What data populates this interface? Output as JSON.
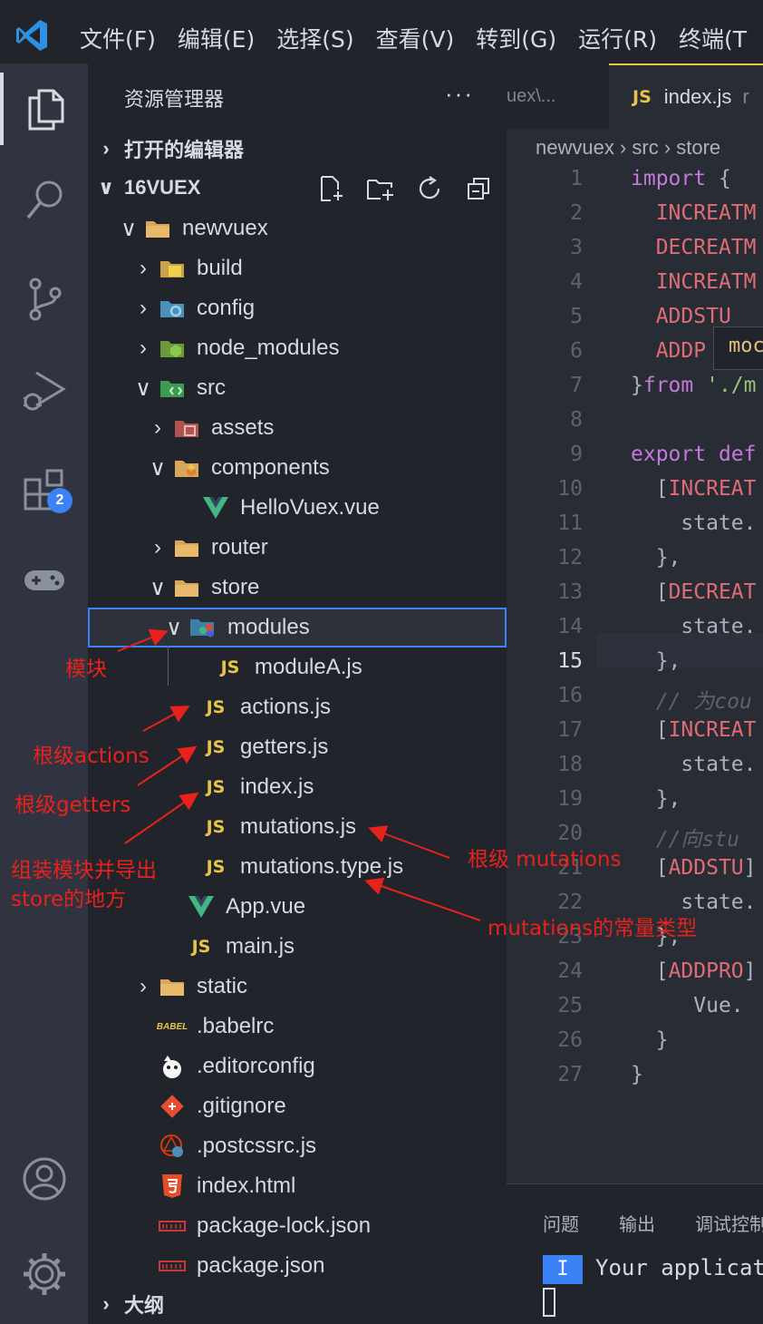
{
  "menu": [
    "文件(F)",
    "编辑(E)",
    "选择(S)",
    "查看(V)",
    "转到(G)",
    "运行(R)",
    "终端(T"
  ],
  "activity_bar": {
    "extensions_badge": "2"
  },
  "sidebar": {
    "title": "资源管理器",
    "more": "···",
    "open_editors": "打开的编辑器",
    "workspace": "16VUEX",
    "outline": "大纲"
  },
  "tree": [
    {
      "label": "newvuex",
      "chev": "∨",
      "icon": "folder-icon"
    },
    {
      "label": "build",
      "chev": "›",
      "icon": "folder-build-icon"
    },
    {
      "label": "config",
      "chev": "›",
      "icon": "folder-config-icon"
    },
    {
      "label": "node_modules",
      "chev": "›",
      "icon": "folder-node-icon"
    },
    {
      "label": "src",
      "chev": "∨",
      "icon": "folder-src-icon"
    },
    {
      "label": "assets",
      "chev": "›",
      "icon": "folder-assets-icon"
    },
    {
      "label": "components",
      "chev": "∨",
      "icon": "folder-components-icon"
    },
    {
      "label": "HelloVuex.vue",
      "chev": "",
      "icon": "vue-icon"
    },
    {
      "label": "router",
      "chev": "›",
      "icon": "folder-icon"
    },
    {
      "label": "store",
      "chev": "∨",
      "icon": "folder-icon"
    },
    {
      "label": "modules",
      "chev": "∨",
      "icon": "folder-modules-icon"
    },
    {
      "label": "moduleA.js",
      "chev": "",
      "icon": "js-icon"
    },
    {
      "label": "actions.js",
      "chev": "",
      "icon": "js-icon"
    },
    {
      "label": "getters.js",
      "chev": "",
      "icon": "js-icon"
    },
    {
      "label": "index.js",
      "chev": "",
      "icon": "js-icon"
    },
    {
      "label": "mutations.js",
      "chev": "",
      "icon": "js-icon"
    },
    {
      "label": "mutations.type.js",
      "chev": "",
      "icon": "js-icon"
    },
    {
      "label": "App.vue",
      "chev": "",
      "icon": "vue-icon"
    },
    {
      "label": "main.js",
      "chev": "",
      "icon": "js-icon"
    },
    {
      "label": "static",
      "chev": "›",
      "icon": "folder-icon"
    },
    {
      "label": ".babelrc",
      "chev": "",
      "icon": "babel-icon"
    },
    {
      "label": ".editorconfig",
      "chev": "",
      "icon": "editorconfig-icon"
    },
    {
      "label": ".gitignore",
      "chev": "",
      "icon": "git-icon"
    },
    {
      "label": ".postcssrc.js",
      "chev": "",
      "icon": "postcss-icon"
    },
    {
      "label": "index.html",
      "chev": "",
      "icon": "html5-icon"
    },
    {
      "label": "package-lock.json",
      "chev": "",
      "icon": "npm-icon"
    },
    {
      "label": "package.json",
      "chev": "",
      "icon": "npm-icon"
    }
  ],
  "js_label": "JS",
  "icon_text": {
    "babel": "BABEL"
  },
  "editor": {
    "tab_inactive": "uex\\...",
    "tab_active": "index.js",
    "tab_active_suffix": "r",
    "breadcrumb": "newvuex › src › store",
    "hover_text": "moc",
    "lines": [
      {
        "n": "1",
        "html": "<span class='kw'>import</span> <span class='pl'>{</span>"
      },
      {
        "n": "2",
        "html": "  <span class='cn'>INCREATM</span>"
      },
      {
        "n": "3",
        "html": "  <span class='cn'>DECREATM</span>"
      },
      {
        "n": "4",
        "html": "  <span class='cn'>INCREATM</span>"
      },
      {
        "n": "5",
        "html": "  <span class='cn'>ADDSTU</span>"
      },
      {
        "n": "6",
        "html": "  <span class='cn'>ADDP</span>"
      },
      {
        "n": "7",
        "html": "<span class='pl'>}</span><span class='kw'>from</span> <span class='st'>'./m</span>"
      },
      {
        "n": "8",
        "html": ""
      },
      {
        "n": "9",
        "html": "<span class='kw'>export</span> <span class='kw'>def</span>"
      },
      {
        "n": "10",
        "html": "  <span class='pl'>[</span><span class='cn'>INCREAT</span>"
      },
      {
        "n": "11",
        "html": "    <span class='pl'>state.</span>"
      },
      {
        "n": "12",
        "html": "  <span class='pl'>},</span>"
      },
      {
        "n": "13",
        "html": "  <span class='pl'>[</span><span class='cn'>DECREAT</span>"
      },
      {
        "n": "14",
        "html": "    <span class='pl'>state.</span>"
      },
      {
        "n": "15",
        "html": "  <span class='pl'>},</span>"
      },
      {
        "n": "16",
        "html": "  <span class='cm'>// 为cou</span>"
      },
      {
        "n": "17",
        "html": "  <span class='pl'>[</span><span class='cn'>INCREAT</span>"
      },
      {
        "n": "18",
        "html": "    <span class='pl'>state.</span>"
      },
      {
        "n": "19",
        "html": "  <span class='pl'>},</span>"
      },
      {
        "n": "20",
        "html": "  <span class='cm'>//向stu</span>"
      },
      {
        "n": "21",
        "html": "  <span class='pl'>[</span><span class='cn'>ADDSTU</span><span class='pl'>]</span>"
      },
      {
        "n": "22",
        "html": "    <span class='pl'>state.</span>"
      },
      {
        "n": "23",
        "html": "  <span class='pl'>},</span>"
      },
      {
        "n": "24",
        "html": "  <span class='pl'>[</span><span class='cn'>ADDPRO</span><span class='pl'>]</span>"
      },
      {
        "n": "25",
        "html": "     <span class='pl'>Vue.</span>"
      },
      {
        "n": "26",
        "html": "  <span class='pl'>}</span>"
      },
      {
        "n": "27",
        "html": "<span class='pl'>}</span>"
      }
    ],
    "current_line": "15"
  },
  "panel": {
    "tabs": [
      "问题",
      "输出",
      "调试控制"
    ],
    "info_badge": "I",
    "terminal_text": "Your applicat"
  },
  "annotations": {
    "modules": "模块",
    "actions": "根级actions",
    "getters": "根级getters",
    "index_line1": "组装模块并导出",
    "index_line2": "store的地方",
    "mutations": "根级 mutations",
    "mutations_type": "mutations的常量类型"
  },
  "colors": {
    "annotation": "#e8211c",
    "selection_border": "#3b82f6",
    "js_icon": "#e8c547",
    "vue_icon": "#41b883"
  }
}
